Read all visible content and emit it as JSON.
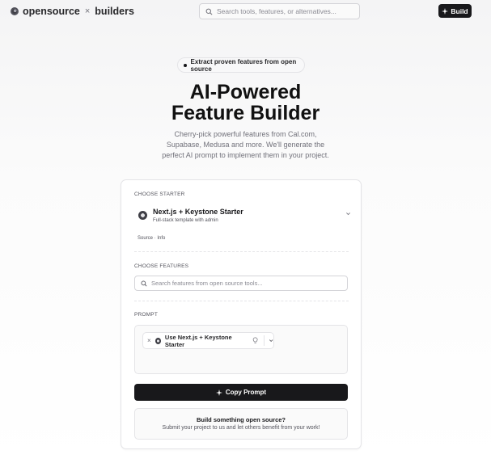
{
  "header": {
    "brand_left": "opensource",
    "brand_x": "×",
    "brand_right": "builders",
    "search_placeholder": "Search tools, features, or alternatives...",
    "build_label": "Build"
  },
  "hero": {
    "pill_text": "Extract proven features from open source",
    "title_line1": "AI-Powered",
    "title_line2": "Feature Builder",
    "subtitle": "Cherry-pick powerful features from Cal.com, Supabase, Medusa and more. We'll generate the perfect AI prompt to implement them in your project."
  },
  "card": {
    "starter_section_label": "CHOOSE STARTER",
    "starter": {
      "name": "Next.js + Keystone Starter",
      "description": "Full-stack template with admin",
      "source_info": "Source · Info"
    },
    "features_section_label": "CHOOSE FEATURES",
    "features_search_placeholder": "Search features from open source tools...",
    "prompt_section_label": "PROMPT",
    "prompt_chip_label": "Use Next.js + Keystone Starter",
    "copy_prompt_label": "Copy Prompt",
    "cta_title": "Build something open source?",
    "cta_subtitle": "Submit your project to us and let others benefit from your work!"
  },
  "icons": {
    "search": "search-icon",
    "sparkle": "sparkle-icon",
    "chevron": "chevron-down-icon",
    "close": "close-icon",
    "bulb": "lightbulb-icon"
  },
  "colors": {
    "primary": "#18181b",
    "background": "#f4f4f5",
    "border": "#e4e4e7",
    "muted_text": "#71717a"
  }
}
